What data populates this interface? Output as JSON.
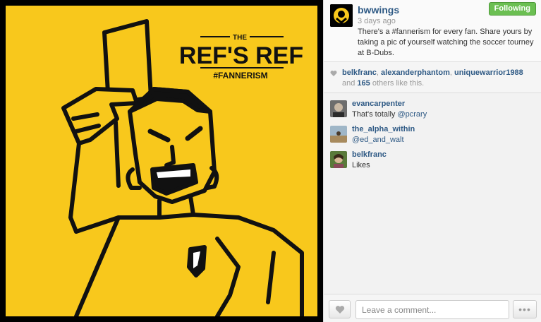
{
  "post": {
    "image_text": {
      "small_title": "THE",
      "main_title": "REF'S REF",
      "hashtag": "#FANNERISM"
    },
    "owner": "bwwings",
    "time_ago": "3 days ago",
    "caption": "There's a #fannerism for every fan. Share yours by taking a pic of yourself watching the soccer tourney at B-Dubs.",
    "follow_label": "Following",
    "colors": {
      "image_bg": "#f8c81c",
      "link": "#2f5a85",
      "follow": "#6bbf52"
    }
  },
  "likes": {
    "users": [
      "belkfranc",
      "alexanderphantom",
      "uniquewarrior1988"
    ],
    "and_text": "and",
    "count": "165",
    "suffix": "others like this."
  },
  "comments": [
    {
      "user": "evancarpenter",
      "prefix": "That's totally ",
      "mention": "@pcrary"
    },
    {
      "user": "the_alpha_within",
      "prefix": "",
      "mention": "@ed_and_walt"
    },
    {
      "user": "belkfranc",
      "prefix": "Likes",
      "mention": ""
    }
  ],
  "footer": {
    "comment_placeholder": "Leave a comment...",
    "more_label": "•••"
  }
}
